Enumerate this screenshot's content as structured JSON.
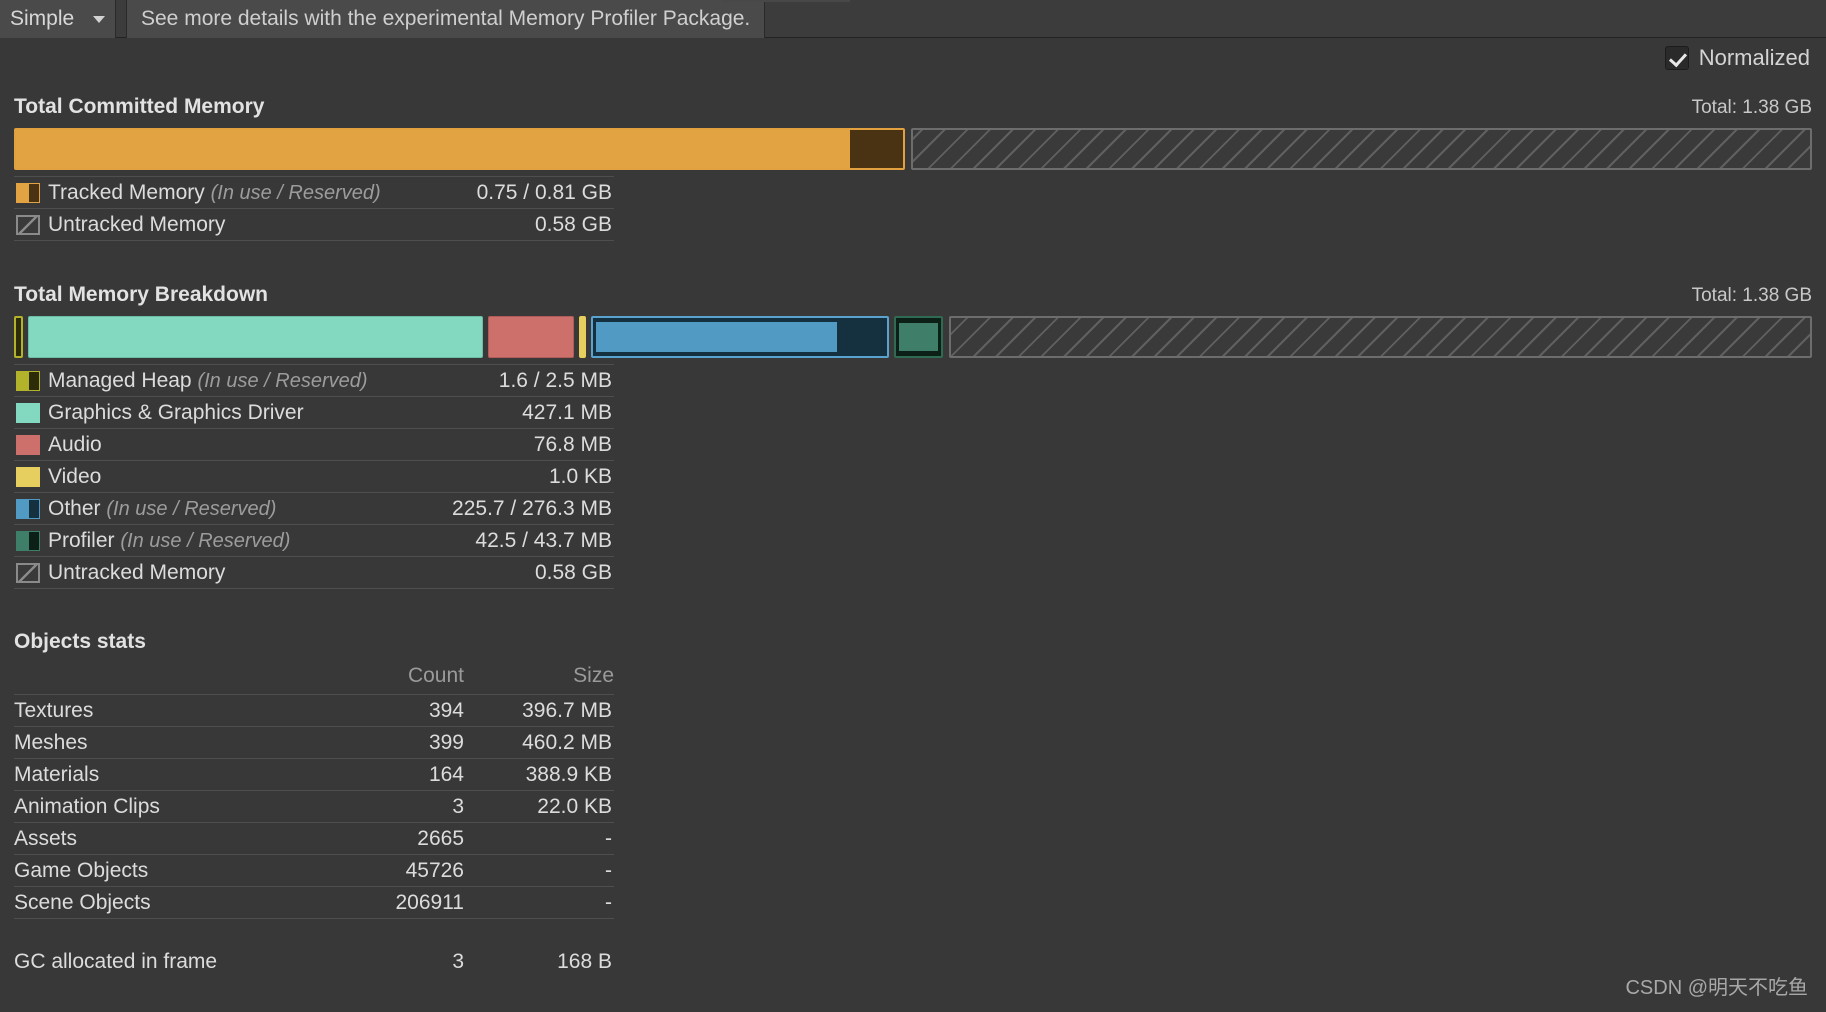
{
  "toolbar": {
    "mode_label": "Simple",
    "caret_icon": "chevron-down-icon",
    "info_text": "See more details with the experimental Memory Profiler Package."
  },
  "options": {
    "normalized_label": "Normalized",
    "normalized_checked": true,
    "check_icon": "check-icon"
  },
  "committed": {
    "title": "Total Committed Memory",
    "total": "Total: 1.38 GB",
    "legend": [
      {
        "label": "Tracked Memory",
        "sub": "(In use / Reserved)",
        "value": "0.75 / 0.81 GB",
        "swatch": "split-orange",
        "color_in_use": "#e2a342",
        "color_reserved": "#4a3313"
      },
      {
        "label": "Untracked Memory",
        "sub": "",
        "value": "0.58 GB",
        "swatch": "hatched-outline",
        "color_in_use": "#3a3a3a",
        "color_reserved": "#8a8a8a"
      }
    ]
  },
  "breakdown": {
    "title": "Total Memory Breakdown",
    "total": "Total: 1.38 GB",
    "legend": [
      {
        "label": "Managed Heap",
        "sub": "(In use / Reserved)",
        "value": "1.6 / 2.5 MB",
        "swatch": "split",
        "color_in_use": "#b3b32b",
        "color_reserved": "#2c2c08"
      },
      {
        "label": "Graphics & Graphics Driver",
        "sub": "",
        "value": "427.1 MB",
        "swatch": "solid",
        "color_in_use": "#82d9bf",
        "color_reserved": "#82d9bf"
      },
      {
        "label": "Audio",
        "sub": "",
        "value": "76.8 MB",
        "swatch": "solid",
        "color_in_use": "#cd6f6b",
        "color_reserved": "#cd6f6b"
      },
      {
        "label": "Video",
        "sub": "",
        "value": "1.0 KB",
        "swatch": "solid",
        "color_in_use": "#e6cf5e",
        "color_reserved": "#e6cf5e"
      },
      {
        "label": "Other",
        "sub": "(In use / Reserved)",
        "value": "225.7 / 276.3 MB",
        "swatch": "split",
        "color_in_use": "#509ac4",
        "color_reserved": "#15313f"
      },
      {
        "label": "Profiler",
        "sub": "(In use / Reserved)",
        "value": "42.5 / 43.7 MB",
        "swatch": "split",
        "color_in_use": "#3f7f69",
        "color_reserved": "#0c2018"
      },
      {
        "label": "Untracked Memory",
        "sub": "",
        "value": "0.58 GB",
        "swatch": "hatched-outline",
        "color_in_use": "#3a3a3a",
        "color_reserved": "#8a8a8a"
      }
    ]
  },
  "objects_stats": {
    "title": "Objects stats",
    "columns": {
      "name": "",
      "count": "Count",
      "size": "Size"
    },
    "rows": [
      {
        "name": "Textures",
        "count": "394",
        "size": "396.7 MB"
      },
      {
        "name": "Meshes",
        "count": "399",
        "size": "460.2 MB"
      },
      {
        "name": "Materials",
        "count": "164",
        "size": "388.9 KB"
      },
      {
        "name": "Animation Clips",
        "count": "3",
        "size": "22.0 KB"
      },
      {
        "name": "Assets",
        "count": "2665",
        "size": "-"
      },
      {
        "name": "Game Objects",
        "count": "45726",
        "size": "-"
      },
      {
        "name": "Scene Objects",
        "count": "206911",
        "size": "-"
      }
    ],
    "gc_row": {
      "name": "GC allocated in frame",
      "count": "3",
      "size": "168 B"
    }
  },
  "watermark": {
    "text": "CSDN @明天不吃鱼"
  }
}
